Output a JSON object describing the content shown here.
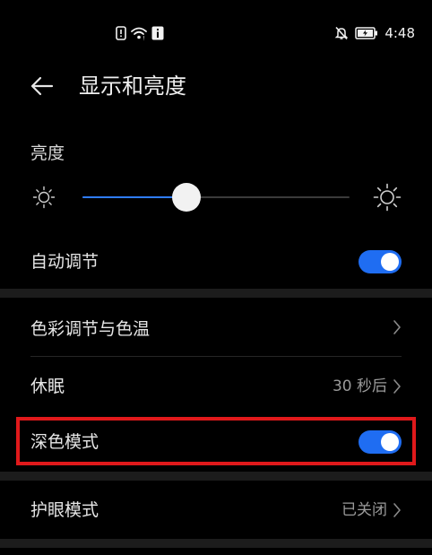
{
  "status_bar": {
    "time": "4:48",
    "left_icons": [
      "alert-icon",
      "wifi-icon",
      "info-icon"
    ],
    "right_icons": [
      "mute-icon",
      "battery-icon"
    ]
  },
  "header": {
    "title": "显示和亮度",
    "back_icon": "back-arrow-icon"
  },
  "brightness": {
    "label": "亮度",
    "level": 0.39,
    "accent_color": "#2f7dff"
  },
  "rows": {
    "auto_adjust": {
      "label": "自动调节",
      "enabled": true
    },
    "color_temp": {
      "label": "色彩调节与色温"
    },
    "sleep": {
      "label": "休眠",
      "value": "30 秒后"
    },
    "dark_mode": {
      "label": "深色模式",
      "enabled": true
    },
    "eye_comfort": {
      "label": "护眼模式",
      "value": "已关闭"
    }
  },
  "colors": {
    "background": "#000000",
    "toggle_on": "#1f6df2",
    "highlight": "#e0191b"
  }
}
